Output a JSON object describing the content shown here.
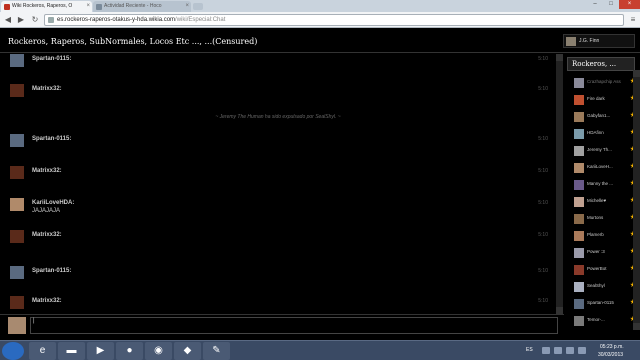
{
  "browser": {
    "tabs": [
      {
        "title": "Wiki Rockeros, Raperos, O",
        "favicon_color": "#c03020"
      },
      {
        "title": "Actividad Reciente - Hoco",
        "favicon_color": "#7a8a9a"
      }
    ],
    "window_controls": {
      "minimize": "–",
      "maximize": "□",
      "close": "×"
    },
    "url": "es.rockeros-raperos-otakus-y-hda.wikia.com",
    "url_path": "/wiki/Especial:Chat"
  },
  "chat": {
    "room_title": "Rockeros, Raperos, SubNormales, Locos Etc ..., ...(Censured)",
    "current_user": "J.G. Finn",
    "inline_alert": "~ Jeremy The Human ha sido expulsado por SealShyl. ~",
    "messages": [
      {
        "user": "Spartan-0115:",
        "text": "",
        "time": "5:10",
        "avatar_color": "#5a6a80"
      },
      {
        "user": "Matrixx32:",
        "text": "",
        "time": "5:10",
        "avatar_color": "#5a2a1a"
      },
      {
        "user": "Spartan-0115:",
        "text": "",
        "time": "5:10",
        "avatar_color": "#5a6a80"
      },
      {
        "user": "Matrixx32:",
        "text": "",
        "time": "5:10",
        "avatar_color": "#5a2a1a"
      },
      {
        "user": "KariiLoveHDA:",
        "text": "JAJAJAJA",
        "time": "5:10",
        "avatar_color": "#b08a6a"
      },
      {
        "user": "Matrixx32:",
        "text": "",
        "time": "5:10",
        "avatar_color": "#5a2a1a"
      },
      {
        "user": "Spartan-0115:",
        "text": "",
        "time": "5:10",
        "avatar_color": "#5a6a80"
      },
      {
        "user": "Matrixx32:",
        "text": "",
        "time": "5:10",
        "avatar_color": "#5a2a1a"
      }
    ],
    "input_value": "|"
  },
  "sidebar": {
    "header": "Rockeros, ...",
    "users": [
      {
        "name": "Crazhapchip Assassin",
        "avatar_color": "#8a8a9a",
        "dim": true
      },
      {
        "name": "Fire dark",
        "avatar_color": "#c05030"
      },
      {
        "name": "Gabyfan1...",
        "avatar_color": "#9a7a5a"
      },
      {
        "name": "HDAfinn",
        "avatar_color": "#7a9aaa"
      },
      {
        "name": "Jeremy Th...",
        "avatar_color": "#a0a0a0"
      },
      {
        "name": "KariiLoveH...",
        "avatar_color": "#b08a6a"
      },
      {
        "name": "Manny the ...",
        "avatar_color": "#6a5a8a"
      },
      {
        "name": "Michelle♥",
        "avatar_color": "#c0a090"
      },
      {
        "name": "Murtons",
        "avatar_color": "#8a6a4a"
      },
      {
        "name": "Plamerb",
        "avatar_color": "#aa7a5a"
      },
      {
        "name": "Power :3",
        "avatar_color": "#9a9aaa"
      },
      {
        "name": "PowerBot",
        "avatar_color": "#8a3a2a"
      },
      {
        "name": "SealShyl",
        "avatar_color": "#aab0c0"
      },
      {
        "name": "Spartan-0115",
        "avatar_color": "#5a6a80"
      },
      {
        "name": "Temor-...",
        "avatar_color": "#7a7a7a"
      }
    ],
    "star_color": "#f5b400"
  },
  "taskbar": {
    "apps": [
      {
        "name": "internet-explorer-icon",
        "glyph": "e"
      },
      {
        "name": "folder-icon",
        "glyph": "▬"
      },
      {
        "name": "media-player-icon",
        "glyph": "▶"
      },
      {
        "name": "firefox-icon",
        "glyph": "●"
      },
      {
        "name": "chrome-icon",
        "glyph": "◉"
      },
      {
        "name": "app-icon",
        "glyph": "◆"
      },
      {
        "name": "paint-icon",
        "glyph": "✎"
      }
    ],
    "lang": "ES",
    "time": "05:23 p.m.",
    "date": "30/03/2013"
  }
}
